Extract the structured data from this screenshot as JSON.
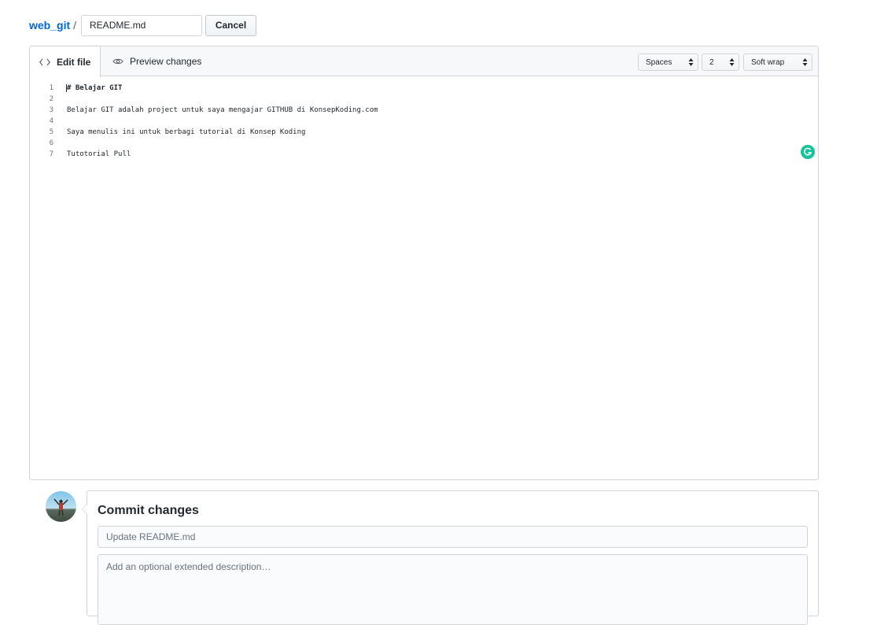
{
  "breadcrumb": {
    "repo": "web_git",
    "separator": "/",
    "filename": "README.md",
    "cancel_label": "Cancel"
  },
  "editor": {
    "tabs": [
      {
        "label": "Edit file",
        "icon": "code-icon",
        "active": true
      },
      {
        "label": "Preview changes",
        "icon": "eye-icon",
        "active": false
      }
    ],
    "indent_mode": "Spaces",
    "indent_size": "2",
    "wrap_mode": "Soft wrap",
    "lines": [
      {
        "num": "1",
        "text": "# Belajar GIT"
      },
      {
        "num": "2",
        "text": ""
      },
      {
        "num": "3",
        "text": "Belajar GIT adalah project untuk saya mengajar GITHUB di KonsepKoding.com"
      },
      {
        "num": "4",
        "text": ""
      },
      {
        "num": "5",
        "text": "Saya menulis ini untuk berbagi tutorial di Konsep Koding"
      },
      {
        "num": "6",
        "text": ""
      },
      {
        "num": "7",
        "text": "Tutotorial Pull"
      }
    ],
    "grammarly_icon": "grammarly-icon",
    "grammarly_color": "#15c39a"
  },
  "commit": {
    "title": "Commit changes",
    "summary_placeholder": "Update README.md",
    "description_placeholder": "Add an optional extended description…"
  },
  "colors": {
    "link": "#0366d6",
    "border": "#d1d5da",
    "header_bg": "#f6f8fa"
  }
}
